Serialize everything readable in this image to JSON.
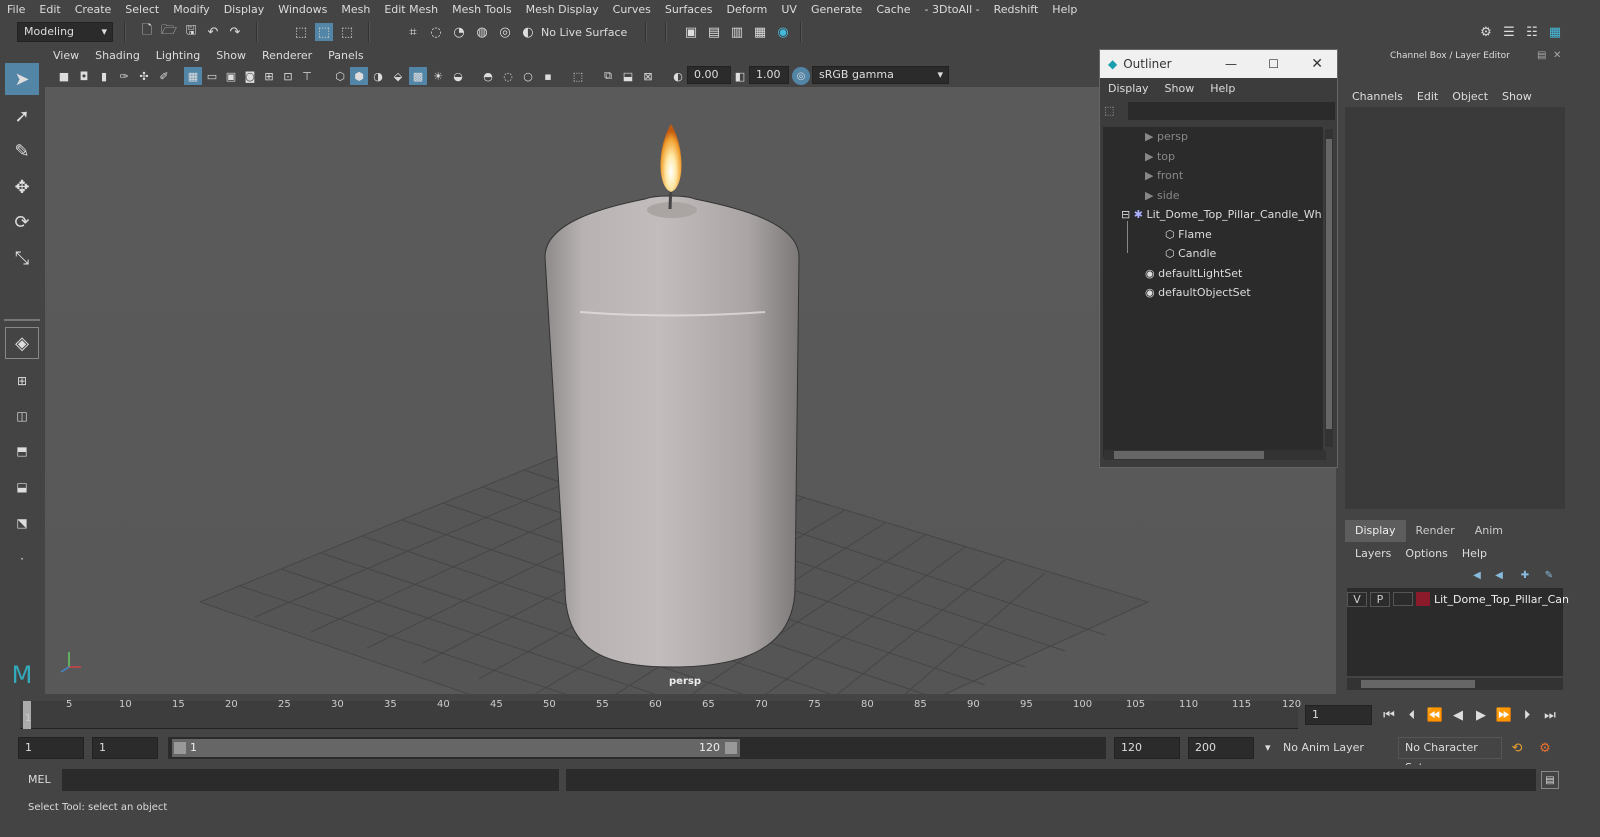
{
  "menubar": {
    "items": [
      "File",
      "Edit",
      "Create",
      "Select",
      "Modify",
      "Display",
      "Windows",
      "Mesh",
      "Edit Mesh",
      "Mesh Tools",
      "Mesh Display",
      "Curves",
      "Surfaces",
      "Deform",
      "UV",
      "Generate",
      "Cache",
      "- 3DtoAll -",
      "Redshift",
      "Help"
    ]
  },
  "shelf": {
    "mode": "Modeling",
    "live_surface": "No Live Surface"
  },
  "viewport": {
    "menu": [
      "View",
      "Shading",
      "Lighting",
      "Show",
      "Renderer",
      "Panels"
    ],
    "exposure": "0.00",
    "gamma": "1.00",
    "color_space": "sRGB gamma",
    "camera_label": "persp"
  },
  "outliner": {
    "title": "Outliner",
    "menu": [
      "Display",
      "Show",
      "Help"
    ],
    "items": [
      {
        "label": "persp",
        "kind": "camera"
      },
      {
        "label": "top",
        "kind": "camera"
      },
      {
        "label": "front",
        "kind": "camera"
      },
      {
        "label": "side",
        "kind": "camera"
      },
      {
        "label": "Lit_Dome_Top_Pillar_Candle_Wh",
        "kind": "group"
      },
      {
        "label": "Flame",
        "kind": "mesh"
      },
      {
        "label": "Candle",
        "kind": "mesh"
      },
      {
        "label": "defaultLightSet",
        "kind": "set"
      },
      {
        "label": "defaultObjectSet",
        "kind": "set"
      }
    ]
  },
  "channel_box": {
    "title": "Channel Box / Layer Editor",
    "menu": [
      "Channels",
      "Edit",
      "Object",
      "Show"
    ]
  },
  "layers": {
    "tabs": [
      "Display",
      "Render",
      "Anim"
    ],
    "menu": [
      "Layers",
      "Options",
      "Help"
    ],
    "row": {
      "v": "V",
      "p": "P",
      "name": "Lit_Dome_Top_Pillar_Can",
      "color": "#8b1a2a"
    }
  },
  "timeline": {
    "ticks": [
      "5",
      "10",
      "15",
      "20",
      "25",
      "30",
      "35",
      "40",
      "45",
      "50",
      "55",
      "60",
      "65",
      "70",
      "75",
      "80",
      "85",
      "90",
      "95",
      "100",
      "105",
      "110",
      "115",
      "120"
    ],
    "start_marker": "1",
    "current_frame": "1"
  },
  "range": {
    "start": "1",
    "playback_start": "1",
    "slider_start": "1",
    "slider_end": "120",
    "playback_end": "120",
    "end": "200",
    "anim_layer": "No Anim Layer",
    "char_set": "No Character Set"
  },
  "cmd": {
    "label": "MEL"
  },
  "status": {
    "text": "Select Tool: select an object"
  },
  "colors": {
    "accent": "#5285a6",
    "layer_color": "#8b1a2a"
  }
}
